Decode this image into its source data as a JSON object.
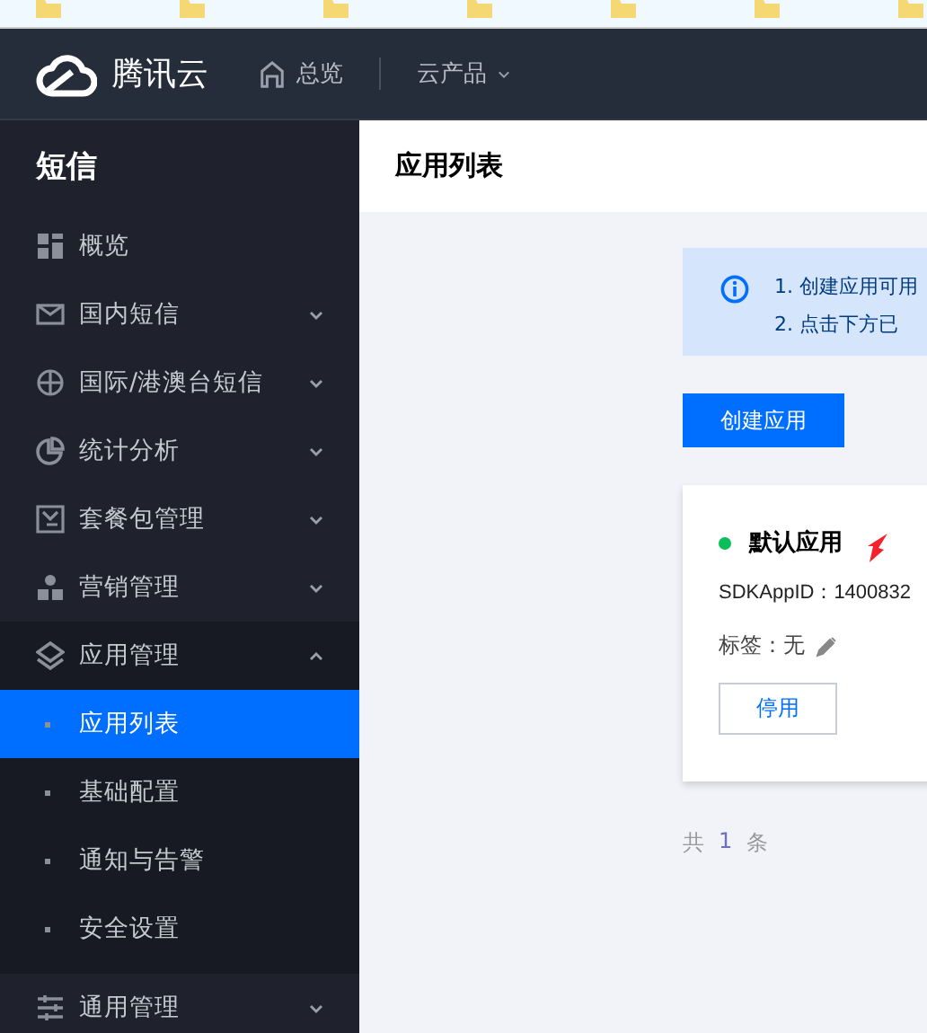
{
  "top_nav": {
    "logo_text": "腾讯云",
    "links": [
      {
        "label": "总览",
        "kind": "home"
      },
      {
        "label": "云产品",
        "kind": "dropdown"
      }
    ]
  },
  "sidebar": {
    "title": "短信",
    "items": [
      {
        "label": "概览",
        "kind": "link"
      },
      {
        "label": "国内短信",
        "kind": "group",
        "expanded": false
      },
      {
        "label": "国际/港澳台短信",
        "kind": "group",
        "expanded": false
      },
      {
        "label": "统计分析",
        "kind": "group",
        "expanded": false
      },
      {
        "label": "套餐包管理",
        "kind": "group",
        "expanded": false
      },
      {
        "label": "营销管理",
        "kind": "group",
        "expanded": false
      },
      {
        "label": "应用管理",
        "kind": "group",
        "expanded": true,
        "children": [
          {
            "label": "应用列表",
            "selected": true
          },
          {
            "label": "基础配置",
            "selected": false
          },
          {
            "label": "通知与告警",
            "selected": false
          },
          {
            "label": "安全设置",
            "selected": false
          }
        ]
      },
      {
        "label": "通用管理",
        "kind": "group",
        "expanded": false
      }
    ]
  },
  "page_title": "应用列表",
  "notice": {
    "lines": [
      "1. 创建应用可用",
      "2. 点击下方已"
    ]
  },
  "create_button": "创建应用",
  "app_card": {
    "name": "默认应用",
    "color": "#0abf5b",
    "sdk_app_id": "SDKAppID：1400832",
    "tag": "标签：无",
    "disable_button": "停用"
  },
  "pagination": {
    "prefix": "共",
    "count": "1",
    "suffix": "条"
  }
}
